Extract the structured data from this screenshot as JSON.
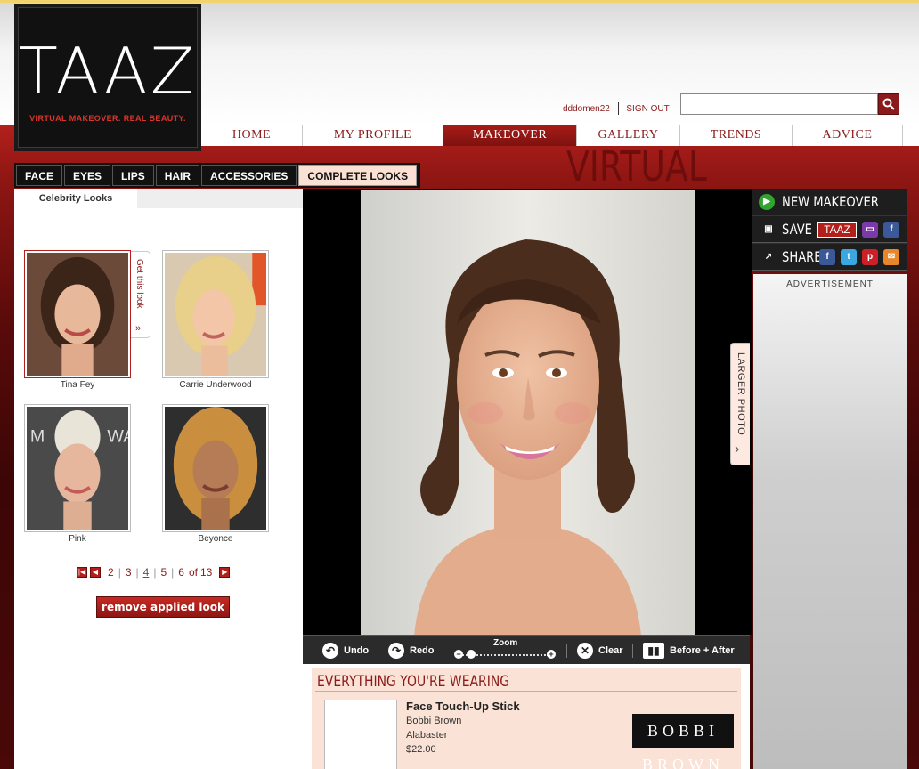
{
  "logo": {
    "title": "TAAZ",
    "tagline": "VIRTUAL MAKEOVER. REAL BEAUTY."
  },
  "user": {
    "name": "dddomen22",
    "sign_out": "SIGN OUT"
  },
  "search": {
    "placeholder": ""
  },
  "nav": [
    {
      "label": "HOME"
    },
    {
      "label": "MY PROFILE"
    },
    {
      "label": "MAKEOVER",
      "active": true
    },
    {
      "label": "GALLERY"
    },
    {
      "label": "TRENDS"
    },
    {
      "label": "ADVICE"
    }
  ],
  "hero_title": "VIRTUAL MAKEOVER",
  "tabs": [
    {
      "label": "FACE"
    },
    {
      "label": "EYES"
    },
    {
      "label": "LIPS"
    },
    {
      "label": "HAIR"
    },
    {
      "label": "ACCESSORIES"
    },
    {
      "label": "COMPLETE LOOKS",
      "active": true
    }
  ],
  "left_panel": {
    "subtab": "Celebrity Looks",
    "get_this_look": "Get this look",
    "celebrities": [
      {
        "name": "Tina Fey",
        "selected": true
      },
      {
        "name": "Carrie Underwood"
      },
      {
        "name": "Pink"
      },
      {
        "name": "Beyonce"
      }
    ],
    "pager": {
      "pages": [
        "2",
        "3",
        "4",
        "5",
        "6"
      ],
      "current": "4",
      "of_label": "of",
      "total": "13"
    },
    "remove_button": "remove applied look"
  },
  "larger_photo": "LARGER PHOTO",
  "toolbar": {
    "undo": "Undo",
    "redo": "Redo",
    "zoom": "Zoom",
    "clear": "Clear",
    "before_after": "Before + After"
  },
  "wearing": {
    "title": "EVERYTHING YOU'RE WEARING",
    "product": {
      "name": "Face Touch-Up Stick",
      "brand": "Bobbi Brown",
      "shade": "Alabaster",
      "price": "$22.00",
      "brand_logo": "BOBBI BROWN"
    }
  },
  "actions": {
    "new_makeover": "NEW MAKEOVER",
    "save": "SAVE",
    "save_taaz": "TAAZ",
    "share": "SHARE"
  },
  "advertisement": "ADVERTISEMENT",
  "colors": {
    "brand_red": "#8b1a1a",
    "accent_red": "#b3201c",
    "toolbar": "#2b2b2b",
    "tab_active": "#fbe0d4"
  }
}
